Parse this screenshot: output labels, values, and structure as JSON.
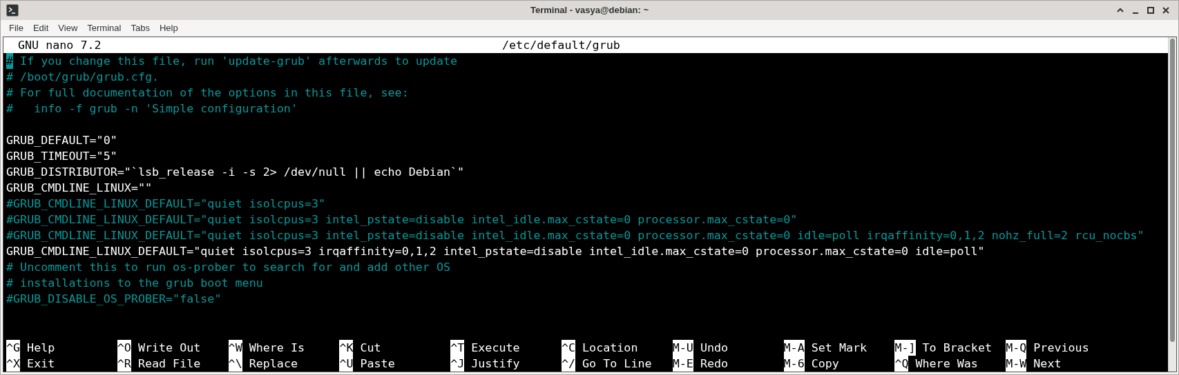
{
  "window": {
    "title": "Terminal - vasya@debian: ~"
  },
  "menu": [
    "File",
    "Edit",
    "View",
    "Terminal",
    "Tabs",
    "Help"
  ],
  "nano": {
    "version": "GNU nano 7.2",
    "file": "/etc/default/grub"
  },
  "lines": [
    {
      "kind": "comment",
      "text": "# If you change this file, run 'update-grub' afterwards to update",
      "cursor": true
    },
    {
      "kind": "comment",
      "text": "# /boot/grub/grub.cfg.",
      "cursor": false
    },
    {
      "kind": "comment",
      "text": "# For full documentation of the options in this file, see:",
      "cursor": false
    },
    {
      "kind": "comment",
      "text": "#   info -f grub -n 'Simple configuration'",
      "cursor": false
    },
    {
      "kind": "blank",
      "cursor": false
    },
    {
      "kind": "code",
      "text": "GRUB_DEFAULT=\"0\"",
      "cursor": false
    },
    {
      "kind": "code",
      "text": "GRUB_TIMEOUT=\"5\"",
      "cursor": false
    },
    {
      "kind": "code",
      "text": "GRUB_DISTRIBUTOR=\"`lsb_release -i -s 2> /dev/null || echo Debian`\"",
      "cursor": false
    },
    {
      "kind": "code",
      "text": "GRUB_CMDLINE_LINUX=\"\"",
      "cursor": false
    },
    {
      "kind": "comment",
      "text": "#GRUB_CMDLINE_LINUX_DEFAULT=\"quiet isolcpus=3\"",
      "cursor": false
    },
    {
      "kind": "comment",
      "text": "#GRUB_CMDLINE_LINUX_DEFAULT=\"quiet isolcpus=3 intel_pstate=disable intel_idle.max_cstate=0 processor.max_cstate=0\"",
      "cursor": false
    },
    {
      "kind": "comment",
      "text": "#GRUB_CMDLINE_LINUX_DEFAULT=\"quiet isolcpus=3 intel_pstate=disable intel_idle.max_cstate=0 processor.max_cstate=0 idle=poll irqaffinity=0,1,2 nohz_full=2 rcu_nocbs\"",
      "cursor": false
    },
    {
      "kind": "code",
      "text": "GRUB_CMDLINE_LINUX_DEFAULT=\"quiet isolcpus=3 irqaffinity=0,1,2 intel_pstate=disable intel_idle.max_cstate=0 processor.max_cstate=0 idle=poll\"",
      "cursor": false
    },
    {
      "kind": "comment",
      "text": "# Uncomment this to run os-prober to search for and add other OS",
      "cursor": false
    },
    {
      "kind": "comment",
      "text": "# installations to the grub boot menu",
      "cursor": false
    },
    {
      "kind": "comment",
      "text": "#GRUB_DISABLE_OS_PROBER=\"false\"",
      "cursor": false
    }
  ],
  "shortcuts": [
    [
      {
        "key": "^G",
        "label": "Help"
      },
      {
        "key": "^O",
        "label": "Write Out"
      },
      {
        "key": "^W",
        "label": "Where Is"
      },
      {
        "key": "^K",
        "label": "Cut"
      },
      {
        "key": "^T",
        "label": "Execute"
      },
      {
        "key": "^C",
        "label": "Location"
      },
      {
        "key": "M-U",
        "label": "Undo"
      },
      {
        "key": "M-A",
        "label": "Set Mark"
      },
      {
        "key": "M-]",
        "label": "To Bracket"
      },
      {
        "key": "M-Q",
        "label": "Previous"
      }
    ],
    [
      {
        "key": "^X",
        "label": "Exit"
      },
      {
        "key": "^R",
        "label": "Read File"
      },
      {
        "key": "^\\",
        "label": "Replace"
      },
      {
        "key": "^U",
        "label": "Paste"
      },
      {
        "key": "^J",
        "label": "Justify"
      },
      {
        "key": "^/",
        "label": "Go To Line"
      },
      {
        "key": "M-E",
        "label": "Redo"
      },
      {
        "key": "M-6",
        "label": "Copy"
      },
      {
        "key": "^Q",
        "label": "Where Was"
      },
      {
        "key": "M-W",
        "label": "Next"
      }
    ]
  ]
}
